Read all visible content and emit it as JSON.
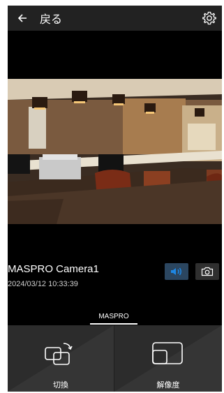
{
  "header": {
    "back_label": "戻る",
    "back_icon": "arrow-left-icon",
    "settings_icon": "gear-icon"
  },
  "camera": {
    "name": "MASPRO Camera1",
    "timestamp": "2024/03/12 10:33:39",
    "audio_icon": "speaker-icon",
    "snapshot_icon": "camera-icon"
  },
  "tabs": [
    {
      "label": "MASPRO",
      "active": true
    }
  ],
  "bottom": {
    "switch_label": "切換",
    "switch_icon": "switch-camera-icon",
    "resolution_label": "解像度",
    "resolution_icon": "resolution-icon"
  },
  "colors": {
    "background": "#000000",
    "header": "#222222",
    "audio_button": "#2b4660",
    "audio_icon": "#1e88e5",
    "bottom_bar": "#2c2c2c"
  }
}
